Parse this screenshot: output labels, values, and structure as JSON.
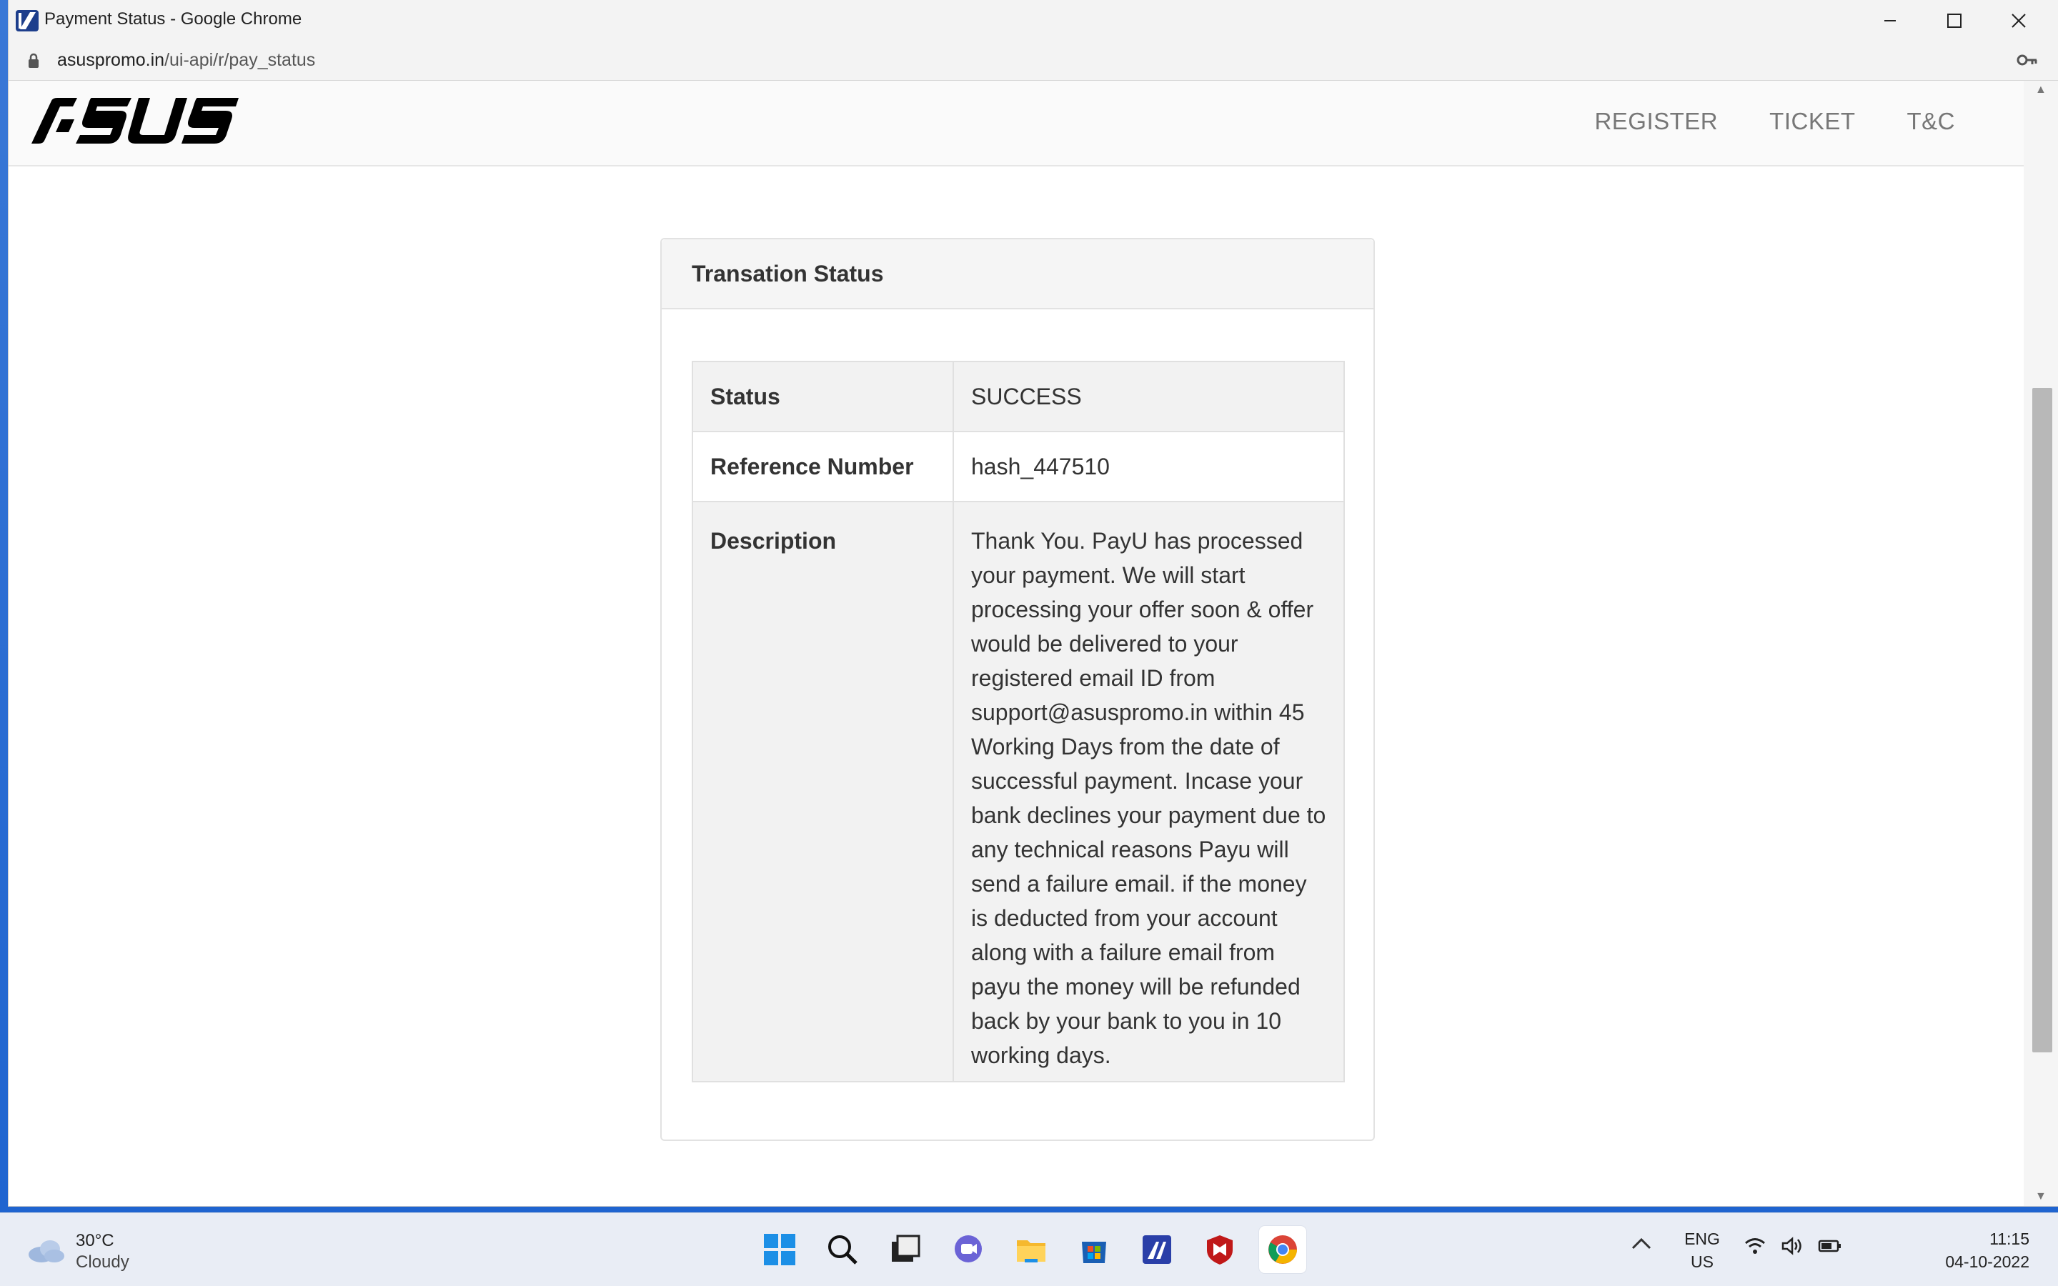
{
  "window": {
    "title": "Payment Status - Google Chrome",
    "url_host": "asuspromo.in",
    "url_path": "/ui-api/r/pay_status"
  },
  "site": {
    "logo": "ASUS",
    "nav": [
      "REGISTER",
      "TICKET",
      "T&C"
    ]
  },
  "panel": {
    "heading": "Transation Status",
    "rows": [
      {
        "label": "Status",
        "value": "SUCCESS"
      },
      {
        "label": "Reference Number",
        "value": "hash_447510"
      },
      {
        "label": "Description",
        "value": "Thank You. PayU has processed your payment. We will start processing your offer soon & offer would be delivered to your registered email ID from support@asuspromo.in within 45 Working Days from the date of successful payment. Incase your bank declines your payment due to any technical reasons Payu will send a failure email. if the money is deducted from your account along with a failure email from payu the money will be refunded back by your bank to you in 10 working days."
      }
    ]
  },
  "taskbar": {
    "weather_temp": "30°C",
    "weather_cond": "Cloudy",
    "lang_top": "ENG",
    "lang_bottom": "US",
    "time": "11:15",
    "date": "04-10-2022",
    "apps": [
      "start-icon",
      "search-icon",
      "task-view-icon",
      "chat-icon",
      "file-explorer-icon",
      "store-icon",
      "editor-app-icon",
      "mcafee-icon",
      "chrome-icon"
    ]
  },
  "colors": {
    "asus_black": "#000000",
    "nav_gray": "#777777",
    "panel_border": "#e2e2e2",
    "row_shade": "#f2f2f2",
    "desktop_blue": "#1d63cf"
  }
}
